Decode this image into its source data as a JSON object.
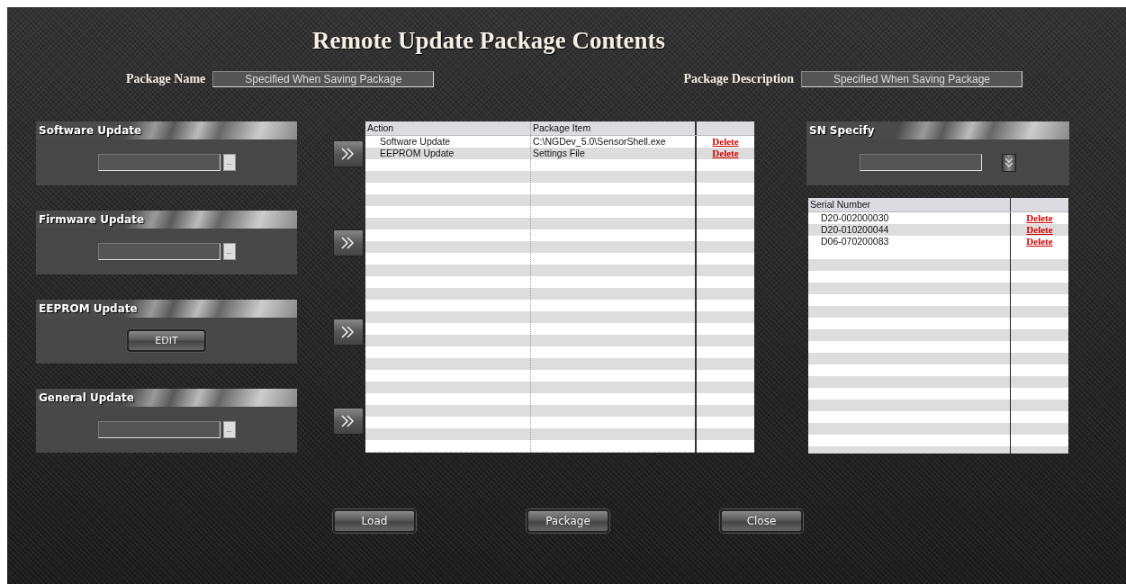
{
  "title": "Remote Update Package Contents",
  "package_name": {
    "label": "Package Name",
    "value": "Specified When Saving Package"
  },
  "package_description": {
    "label": "Package Description",
    "value": "Specified When Saving Package"
  },
  "update_panels": [
    {
      "title": "Software Update",
      "kind": "file",
      "browse": "..."
    },
    {
      "title": "Firmware Update",
      "kind": "file",
      "browse": "..."
    },
    {
      "title": "EEPROM Update",
      "kind": "edit",
      "button": "EDIT"
    },
    {
      "title": "General Update",
      "kind": "file",
      "browse": "..."
    }
  ],
  "package_table": {
    "columns": [
      "Action",
      "Package Item"
    ],
    "rows": [
      {
        "action": "Software Update",
        "item": "C:\\NGDev_5.0\\SensorShell.exe",
        "delete": "Delete"
      },
      {
        "action": "EEPROM Update",
        "item": "Settings File",
        "delete": "Delete"
      }
    ]
  },
  "sn_specify": {
    "title": "SN Specify"
  },
  "serial_table": {
    "columns": [
      "Serial Number"
    ],
    "rows": [
      {
        "serial": "D20-002000030",
        "delete": "Delete"
      },
      {
        "serial": "D20-010200044",
        "delete": "Delete"
      },
      {
        "serial": "D06-070200083",
        "delete": "Delete"
      }
    ]
  },
  "buttons": [
    "Load",
    "Package",
    "Close"
  ]
}
